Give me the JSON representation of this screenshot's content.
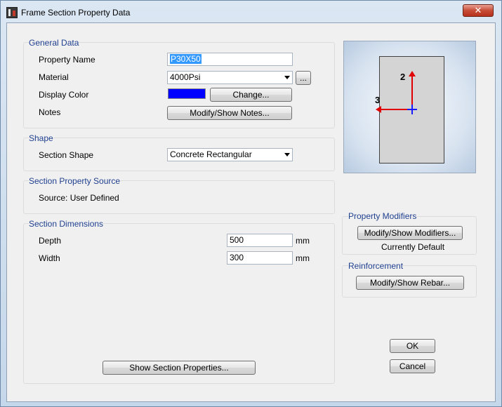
{
  "window": {
    "title": "Frame Section Property Data",
    "close_label": "✕"
  },
  "general": {
    "title": "General Data",
    "property_name_label": "Property Name",
    "property_name_value": "P30X50",
    "material_label": "Material",
    "material_value": "4000Psi",
    "material_more_label": "...",
    "display_color_label": "Display Color",
    "display_color_value": "#0000ff",
    "change_label": "Change...",
    "notes_label": "Notes",
    "notes_button_label": "Modify/Show Notes..."
  },
  "shape": {
    "title": "Shape",
    "section_shape_label": "Section Shape",
    "section_shape_value": "Concrete Rectangular"
  },
  "source": {
    "title": "Section Property Source",
    "text": "Source:  User Defined"
  },
  "dimensions": {
    "title": "Section Dimensions",
    "depth_label": "Depth",
    "depth_value": "500",
    "depth_unit": "mm",
    "width_label": "Width",
    "width_value": "300",
    "width_unit": "mm",
    "show_props_label": "Show Section Properties..."
  },
  "preview": {
    "axis2_label": "2",
    "axis3_label": "3"
  },
  "modifiers": {
    "title": "Property Modifiers",
    "button_label": "Modify/Show Modifiers...",
    "status": "Currently Default"
  },
  "reinforcement": {
    "title": "Reinforcement",
    "button_label": "Modify/Show Rebar..."
  },
  "actions": {
    "ok_label": "OK",
    "cancel_label": "Cancel"
  }
}
